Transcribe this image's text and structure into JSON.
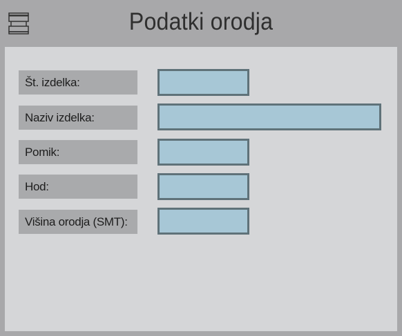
{
  "header": {
    "title": "Podatki orodja",
    "icon": "press-tool-icon"
  },
  "form": {
    "rows": [
      {
        "label": "Št. izdelka:",
        "value": ""
      },
      {
        "label": "Naziv izdelka:",
        "value": ""
      },
      {
        "label": "Pomik:",
        "value": ""
      },
      {
        "label": "Hod:",
        "value": ""
      },
      {
        "label": "Višina orodja (SMT):",
        "value": ""
      }
    ]
  },
  "colors": {
    "background": "#a8a8aa",
    "panel": "#d5d6d8",
    "label_bg": "#a9aaac",
    "field_bg": "#a7c7d6",
    "field_border": "#5f7279"
  }
}
